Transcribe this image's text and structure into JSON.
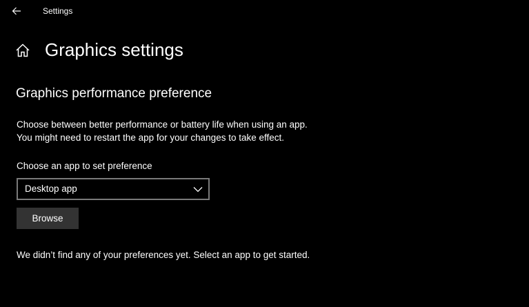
{
  "window": {
    "title": "Settings",
    "back_icon": "arrow-left-icon"
  },
  "page": {
    "home_icon": "home-icon",
    "title": "Graphics settings"
  },
  "section": {
    "title": "Graphics performance preference",
    "description_line1": "Choose between better performance or battery life when using an app.",
    "description_line2": "You might need to restart the app for your changes to take effect."
  },
  "app_picker": {
    "label": "Choose an app to set preference",
    "selected_value": "Desktop app",
    "chevron_icon": "chevron-down-icon",
    "browse_label": "Browse"
  },
  "empty_state": {
    "message": "We didn’t find any of your preferences yet. Select an app to get started."
  },
  "colors": {
    "background": "#000000",
    "text": "#ffffff",
    "dropdown_border": "#7a7a7a",
    "button_background": "#333333"
  }
}
